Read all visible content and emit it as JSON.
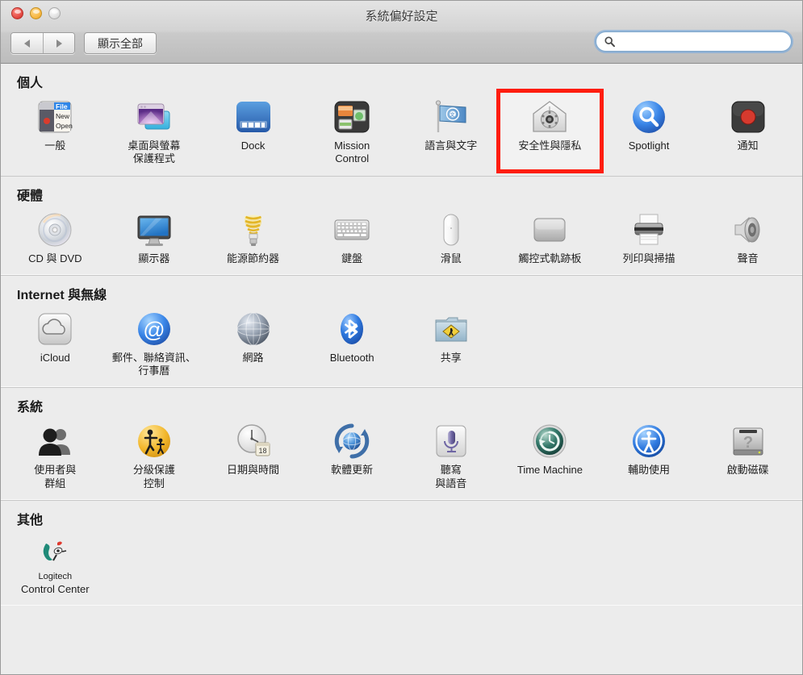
{
  "window": {
    "title": "系統偏好設定",
    "traffic_lights": [
      "close",
      "minimize",
      "zoom"
    ]
  },
  "toolbar": {
    "back_label": "back-arrow",
    "forward_label": "forward-arrow",
    "show_all_label": "顯示全部",
    "search": {
      "value": "",
      "placeholder": ""
    }
  },
  "highlight": {
    "color": "#ff1d0f",
    "target": "安全性與隱私"
  },
  "sections": [
    {
      "id": "personal",
      "title": "個人",
      "items": [
        {
          "label": "一般",
          "icon": "general-icon"
        },
        {
          "label": "桌面與螢幕\n保護程式",
          "icon": "desktop-screensaver-icon"
        },
        {
          "label": "Dock",
          "icon": "dock-icon"
        },
        {
          "label": "Mission\nControl",
          "icon": "mission-control-icon"
        },
        {
          "label": "語言與文字",
          "icon": "language-text-icon"
        },
        {
          "label": "安全性與隱私",
          "icon": "security-privacy-icon",
          "highlighted": true
        },
        {
          "label": "Spotlight",
          "icon": "spotlight-icon"
        },
        {
          "label": "通知",
          "icon": "notifications-icon"
        }
      ]
    },
    {
      "id": "hardware",
      "title": "硬體",
      "items": [
        {
          "label": "CD 與 DVD",
          "icon": "cd-dvd-icon"
        },
        {
          "label": "顯示器",
          "icon": "displays-icon"
        },
        {
          "label": "能源節約器",
          "icon": "energy-saver-icon"
        },
        {
          "label": "鍵盤",
          "icon": "keyboard-icon"
        },
        {
          "label": "滑鼠",
          "icon": "mouse-icon"
        },
        {
          "label": "觸控式軌跡板",
          "icon": "trackpad-icon"
        },
        {
          "label": "列印與掃描",
          "icon": "print-scan-icon"
        },
        {
          "label": "聲音",
          "icon": "sound-icon"
        }
      ]
    },
    {
      "id": "internet",
      "title": "Internet 與無線",
      "items": [
        {
          "label": "iCloud",
          "icon": "icloud-icon"
        },
        {
          "label": "郵件、聯絡資訊、\n行事曆",
          "icon": "mail-contacts-calendars-icon"
        },
        {
          "label": "網路",
          "icon": "network-icon"
        },
        {
          "label": "Bluetooth",
          "icon": "bluetooth-icon"
        },
        {
          "label": "共享",
          "icon": "sharing-icon"
        }
      ]
    },
    {
      "id": "system",
      "title": "系統",
      "items": [
        {
          "label": "使用者與\n群組",
          "icon": "users-groups-icon"
        },
        {
          "label": "分級保護\n控制",
          "icon": "parental-controls-icon"
        },
        {
          "label": "日期與時間",
          "icon": "date-time-icon",
          "badge": "18"
        },
        {
          "label": "軟體更新",
          "icon": "software-update-icon"
        },
        {
          "label": "聽寫\n與語音",
          "icon": "dictation-speech-icon"
        },
        {
          "label": "Time Machine",
          "icon": "time-machine-icon"
        },
        {
          "label": "輔助使用",
          "icon": "accessibility-icon"
        },
        {
          "label": "啟動磁碟",
          "icon": "startup-disk-icon"
        }
      ]
    },
    {
      "id": "other",
      "title": "其他",
      "items": [
        {
          "label": "Control Center",
          "icon": "logitech-control-center-icon",
          "sublabel": "Logitech"
        }
      ]
    }
  ]
}
